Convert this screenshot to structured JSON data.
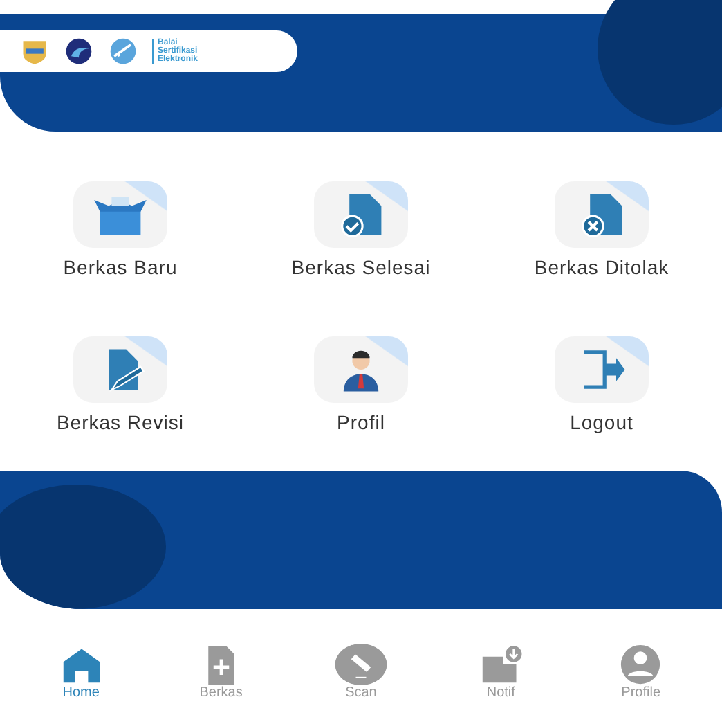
{
  "header": {
    "logo_text": "Balai Sertifikasi Elektronik"
  },
  "menu": {
    "items": [
      {
        "label": "Berkas Baru",
        "kind": "box"
      },
      {
        "label": "Berkas Selesai",
        "kind": "done"
      },
      {
        "label": "Berkas Ditolak",
        "kind": "rejected"
      },
      {
        "label": "Berkas Revisi",
        "kind": "revise"
      },
      {
        "label": "Profil",
        "kind": "person"
      },
      {
        "label": "Logout",
        "kind": "exit"
      }
    ]
  },
  "nav": {
    "items": [
      {
        "label": "Home",
        "kind": "home",
        "selected": true
      },
      {
        "label": "Berkas",
        "kind": "file",
        "selected": false
      },
      {
        "label": "Scan",
        "kind": "scan",
        "selected": false
      },
      {
        "label": "Notif",
        "kind": "notif",
        "selected": false
      },
      {
        "label": "Profile",
        "kind": "user",
        "selected": false
      }
    ]
  }
}
